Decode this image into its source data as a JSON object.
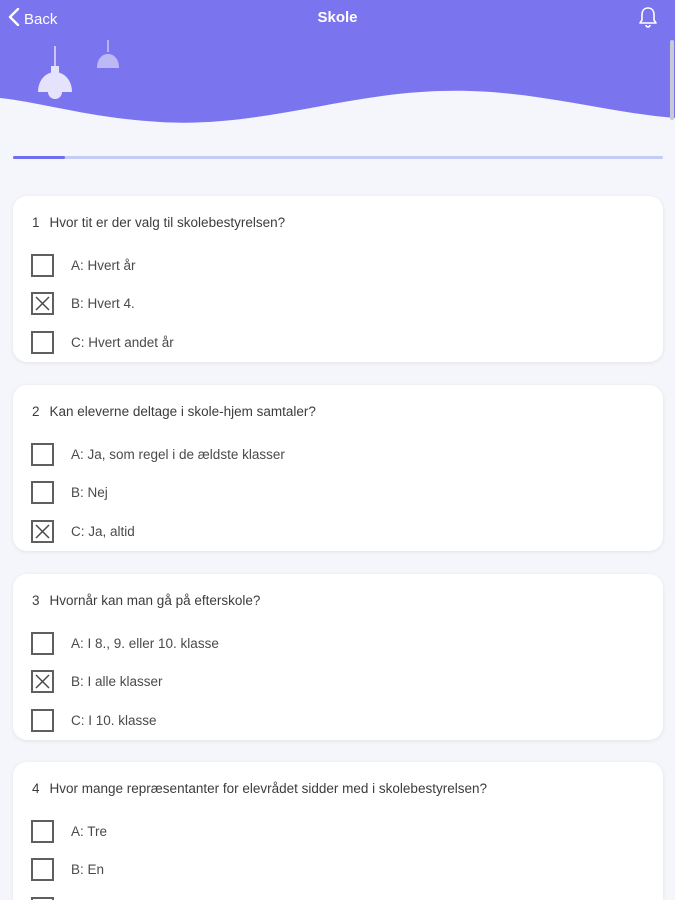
{
  "header": {
    "back_label": "Back",
    "title": "Skole",
    "accent_color": "#7b74ef",
    "icons": {
      "back": "chevron-left-icon",
      "bell": "bell-icon",
      "lamps": "pendant-lamp-icon"
    }
  },
  "progress": {
    "fraction": 0.08
  },
  "questions": [
    {
      "number": "1",
      "text": "Hvor tit er der valg til skolebestyrelsen?",
      "options": [
        {
          "label": "A: Hvert år",
          "checked": false
        },
        {
          "label": "B: Hvert 4.",
          "checked": true
        },
        {
          "label": "C: Hvert andet år",
          "checked": false
        }
      ]
    },
    {
      "number": "2",
      "text": "Kan eleverne deltage i skole-hjem samtaler?",
      "options": [
        {
          "label": "A: Ja, som regel i de ældste klasser",
          "checked": false
        },
        {
          "label": "B: Nej",
          "checked": false
        },
        {
          "label": "C: Ja, altid",
          "checked": true
        }
      ]
    },
    {
      "number": "3",
      "text": "Hvornår kan man gå på efterskole?",
      "options": [
        {
          "label": "A: I 8., 9. eller 10. klasse",
          "checked": false
        },
        {
          "label": "B: I alle klasser",
          "checked": true
        },
        {
          "label": "C: I 10. klasse",
          "checked": false
        }
      ]
    },
    {
      "number": "4",
      "text": "Hvor mange repræsentanter for elevrådet sidder med i skolebestyrelsen?",
      "options": [
        {
          "label": "A: Tre",
          "checked": false
        },
        {
          "label": "B: En",
          "checked": false
        },
        {
          "label": "",
          "checked": false
        }
      ]
    }
  ]
}
